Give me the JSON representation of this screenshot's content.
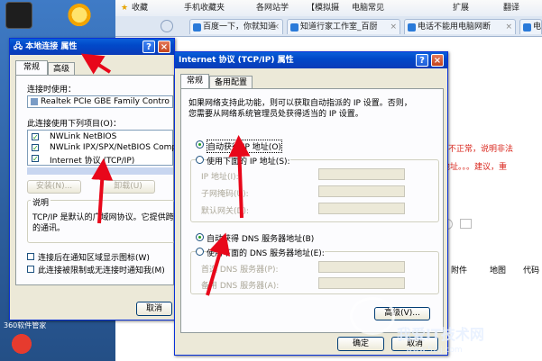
{
  "desktop": {
    "icon1_label": "",
    "icon2_label": "",
    "bottom_label": "360软件管家"
  },
  "browser": {
    "bookmarks": [
      "收藏",
      "手机收藏夹",
      "各网站学",
      "【模拟摄",
      "电脑常见"
    ],
    "bookmark_right": [
      "扩展",
      "翻译"
    ],
    "tabs": [
      "百度一下，你就知道",
      "知道行家工作室_百厨",
      "电话不能用电脑网断",
      "电"
    ],
    "content_text_1": "接不正常，说明非法",
    "content_text_2": "地址。。。建议，重",
    "right_links": [
      "附件",
      "地图",
      "代码"
    ]
  },
  "lan_dialog": {
    "title": "本地连接 属性",
    "tabs": [
      "常规",
      "高级"
    ],
    "connect_using_label": "连接时使用：",
    "adapter_name": "Realtek PCIe GBE Family Contro",
    "items_label": "此连接使用下列项目(O)：",
    "items": [
      "NWLink NetBIOS",
      "NWLink IPX/SPX/NetBIOS Compat",
      "Internet 协议 (TCP/IP)"
    ],
    "install_button": "安装(N)...",
    "uninstall_button": "卸载(U)",
    "description_title": "说明",
    "description_text_1": "TCP/IP 是默认的广域网协议。它提供跨",
    "description_text_2": "的通讯。",
    "show_icon_label": "连接后在通知区域显示图标(W)",
    "notify_label": "此连接被限制或无连接时通知我(M)",
    "cancel_button": "取消"
  },
  "tcpip_dialog": {
    "title": "Internet 协议 (TCP/IP) 属性",
    "tabs": [
      "常规",
      "备用配置"
    ],
    "intro_1": "如果网络支持此功能，则可以获取自动指派的 IP 设置。否则，",
    "intro_2": "您需要从网络系统管理员处获得适当的 IP 设置。",
    "auto_ip_label": "自动获得 IP 地址(O)",
    "manual_ip_label": "使用下面的 IP 地址(S):",
    "ip_label": "IP 地址(I):",
    "mask_label": "子网掩码(U):",
    "gateway_label": "默认网关(D):",
    "auto_dns_label": "自动获得 DNS 服务器地址(B)",
    "manual_dns_label": "使用下面的 DNS 服务器地址(E):",
    "dns1_label": "首选 DNS 服务器(P):",
    "dns2_label": "备用 DNS 服务器(A):",
    "advanced_button": "高级(V)...",
    "ok_button": "确定",
    "cancel_button": "取消"
  },
  "watermark": {
    "main": "我爱IT技术网",
    "sub": "www.52ij.com"
  },
  "colors": {
    "xp_title_blue": "#0149c9",
    "xp_face": "#ece9d8",
    "arrow_red": "#e8071a",
    "link_red": "#d9261c"
  }
}
